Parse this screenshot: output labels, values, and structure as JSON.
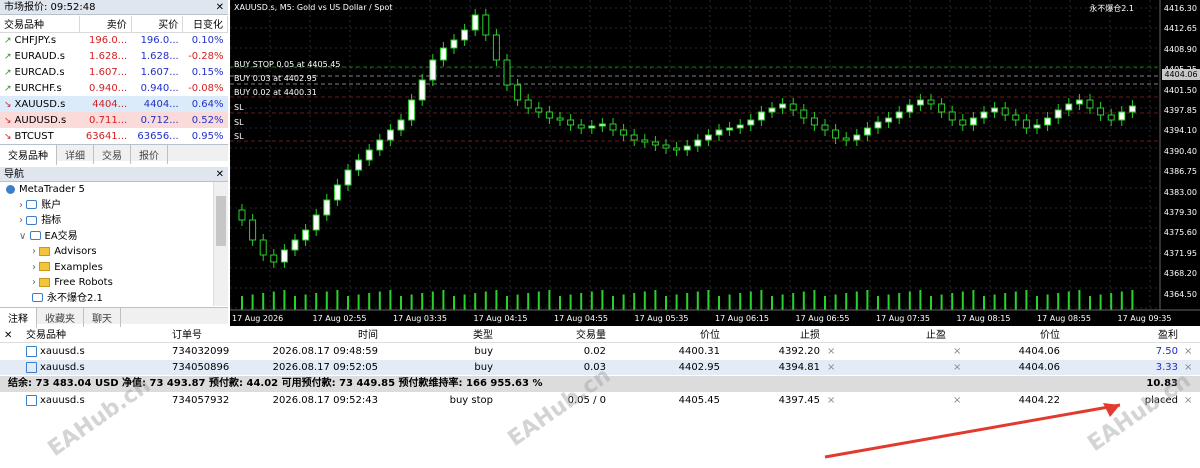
{
  "market_watch": {
    "title": "市场报价: 09:52:48",
    "headers": [
      "交易品种",
      "卖价",
      "买价",
      "日变化"
    ],
    "rows": [
      {
        "symbol": "CHFJPY.s",
        "bid": "196.0...",
        "ask": "196.0...",
        "change": "0.10%",
        "dir": "up"
      },
      {
        "symbol": "EURAUD.s",
        "bid": "1.628...",
        "ask": "1.628...",
        "change": "-0.28%",
        "dir": "up"
      },
      {
        "symbol": "EURCAD.s",
        "bid": "1.607...",
        "ask": "1.607...",
        "change": "0.15%",
        "dir": "up"
      },
      {
        "symbol": "EURCHF.s",
        "bid": "0.940...",
        "ask": "0.940...",
        "change": "-0.08%",
        "dir": "up"
      },
      {
        "symbol": "XAUUSD.s",
        "bid": "4404...",
        "ask": "4404...",
        "change": "0.64%",
        "dir": "down"
      },
      {
        "symbol": "AUDUSD.s",
        "bid": "0.711...",
        "ask": "0.712...",
        "change": "0.52%",
        "dir": "down"
      },
      {
        "symbol": "BTCUST",
        "bid": "63641...",
        "ask": "63656...",
        "change": "0.95%",
        "dir": "down"
      }
    ],
    "tabs": [
      "交易品种",
      "详细",
      "交易",
      "报价"
    ]
  },
  "navigator": {
    "title": "导航",
    "items": [
      {
        "label": "MetaTrader 5",
        "level": 0
      },
      {
        "label": "账户",
        "level": 1
      },
      {
        "label": "指标",
        "level": 1
      },
      {
        "label": "EA交易",
        "level": 1
      },
      {
        "label": "Advisors",
        "level": 2
      },
      {
        "label": "Examples",
        "level": 2
      },
      {
        "label": "Free Robots",
        "level": 2
      },
      {
        "label": "永不爆仓2.1",
        "level": 2
      }
    ],
    "tabs": [
      "注释",
      "收藏夹",
      "聊天"
    ]
  },
  "chart": {
    "title": "XAUUSD.s, M5:  Gold vs US Dollar / Spot",
    "ea_label": "永不爆仓2.1",
    "order_labels": [
      "BUY STOP 0.05 at 4405.45",
      "BUY 0.03 at 4402.95",
      "BUY 0.02 at 4400.31",
      "SL",
      "SL",
      "SL"
    ],
    "current_price": "4404.06",
    "price_axis": [
      "4416.30",
      "4412.65",
      "4408.90",
      "4405.25",
      "4401.50",
      "4397.85",
      "4394.10",
      "4390.40",
      "4386.75",
      "4383.00",
      "4379.30",
      "4375.60",
      "4371.95",
      "4368.20",
      "4364.50"
    ],
    "time_axis": [
      "17 Aug 2026",
      "17 Aug 02:55",
      "17 Aug 03:35",
      "17 Aug 04:15",
      "17 Aug 04:55",
      "17 Aug 05:35",
      "17 Aug 06:15",
      "17 Aug 06:55",
      "17 Aug 07:35",
      "17 Aug 08:15",
      "17 Aug 08:55",
      "17 Aug 09:35"
    ],
    "watermark": "EAHub.cn"
  },
  "toolbox": {
    "headers": [
      "交易品种",
      "订单号",
      "时间",
      "类型",
      "交易量",
      "价位",
      "止损",
      "止盈",
      "价位",
      "盈利"
    ],
    "positions": [
      {
        "symbol": "xauusd.s",
        "ticket": "734032099",
        "time": "2026.08.17 09:48:59",
        "type": "buy",
        "volume": "0.02",
        "price": "4400.31",
        "sl": "4392.20",
        "tp": "",
        "cur": "4404.06",
        "profit": "7.50"
      },
      {
        "symbol": "xauusd.s",
        "ticket": "734050896",
        "time": "2026.08.17 09:52:05",
        "type": "buy",
        "volume": "0.03",
        "price": "4402.95",
        "sl": "4394.81",
        "tp": "",
        "cur": "4404.06",
        "profit": "3.33"
      }
    ],
    "balance_line": "结余: 73 483.04 USD  净值: 73 493.87  预付款: 44.02  可用预付款: 73 449.85  预付款维持率: 166 955.63 %",
    "balance_profit": "10.83",
    "orders": [
      {
        "symbol": "xauusd.s",
        "ticket": "734057932",
        "time": "2026.08.17 09:52:43",
        "type": "buy stop",
        "volume": "0.05 / 0",
        "price": "4405.45",
        "sl": "4397.45",
        "tp": "",
        "cur": "4404.22",
        "profit": "placed"
      }
    ]
  }
}
